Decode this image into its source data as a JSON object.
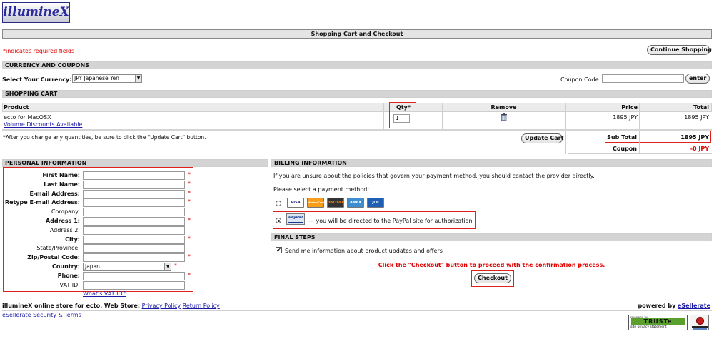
{
  "logo": {
    "text": "illumineX"
  },
  "header": {
    "title": "Shopping Cart and Checkout"
  },
  "required_note": {
    "star": "*",
    "text": "indicates required fields"
  },
  "continue_shopping": "Continue Shopping",
  "currency": {
    "section_title": "CURRENCY AND COUPONS",
    "label": "Select Your Currency:",
    "selected": "JPY Japanese Yen",
    "coupon_label": "Coupon Code:",
    "coupon_value": "",
    "enter_button": "enter"
  },
  "cart": {
    "section_title": "SHOPPING CART",
    "columns": [
      "Product",
      "Qty*",
      "Remove",
      "Price",
      "Total"
    ],
    "item": {
      "name": "ecto for MacOSX",
      "discount_link": "Volume Discounts Available",
      "qty": "1",
      "price": "1895 JPY",
      "total": "1895 JPY"
    },
    "update_note": "*After you change any quantities, be sure to click the \"Update Cart\" button.",
    "update_button": "Update Cart",
    "subtotal_label": "Sub Total",
    "subtotal_value": "1895 JPY",
    "coupon_label": "Coupon",
    "coupon_value": "-0 JPY"
  },
  "personal": {
    "section_title": "PERSONAL INFORMATION",
    "fields": [
      {
        "label": "First Name:",
        "required": true,
        "value": ""
      },
      {
        "label": "Last Name:",
        "required": true,
        "value": ""
      },
      {
        "label": "E-mail Address:",
        "required": true,
        "value": ""
      },
      {
        "label": "Retype E-mail Address:",
        "required": true,
        "value": ""
      },
      {
        "label": "Company:",
        "required": false,
        "value": ""
      },
      {
        "label": "Address 1:",
        "required": true,
        "value": ""
      },
      {
        "label": "Address 2:",
        "required": false,
        "value": ""
      },
      {
        "label": "City:",
        "required": true,
        "value": ""
      },
      {
        "label": "State/Province:",
        "required": false,
        "value": ""
      },
      {
        "label": "Zip/Postal Code:",
        "required": true,
        "value": ""
      },
      {
        "label": "Country:",
        "required": true,
        "value": "Japan"
      },
      {
        "label": "Phone:",
        "required": true,
        "value": ""
      },
      {
        "label": "VAT ID:",
        "required": false,
        "value": ""
      }
    ],
    "vat_link": "What's VAT ID?"
  },
  "billing": {
    "section_title": "BILLING INFORMATION",
    "policy_note": "If you are unsure about the policies that govern your payment method, you should contact the provider directly.",
    "select_label": "Please select a payment method:",
    "cards": [
      "VISA",
      "MasterCard",
      "DISCOVER",
      "AMEX",
      "JCB"
    ],
    "paypal_logo": "PayPal",
    "paypal_text": "— you will be directed to the PayPal site for authorization",
    "selected_method": "paypal"
  },
  "final": {
    "section_title": "FINAL STEPS",
    "newsletter_label": "Send me information about product updates and offers",
    "newsletter_checked": true,
    "instruction": "Click the \"Checkout\" button to proceed with the confirmation process.",
    "checkout_button": "Checkout"
  },
  "footer": {
    "store_text": "illumineX online store for ecto. Web Store:",
    "privacy_link": "Privacy Policy",
    "return_link": "Return Policy",
    "powered_by": "powered by",
    "powered_link": "eSellerate",
    "security_link": "eSellerate Security & Terms",
    "truste_top": "reviewed by",
    "truste_logo": "TRUSTe",
    "truste_sub": "site privacy statement"
  },
  "colors": {
    "accent_red": "#e00000",
    "link_blue": "#1a1aa6",
    "bar_gray": "#d4d4d4",
    "highlight": "#e0201a"
  }
}
